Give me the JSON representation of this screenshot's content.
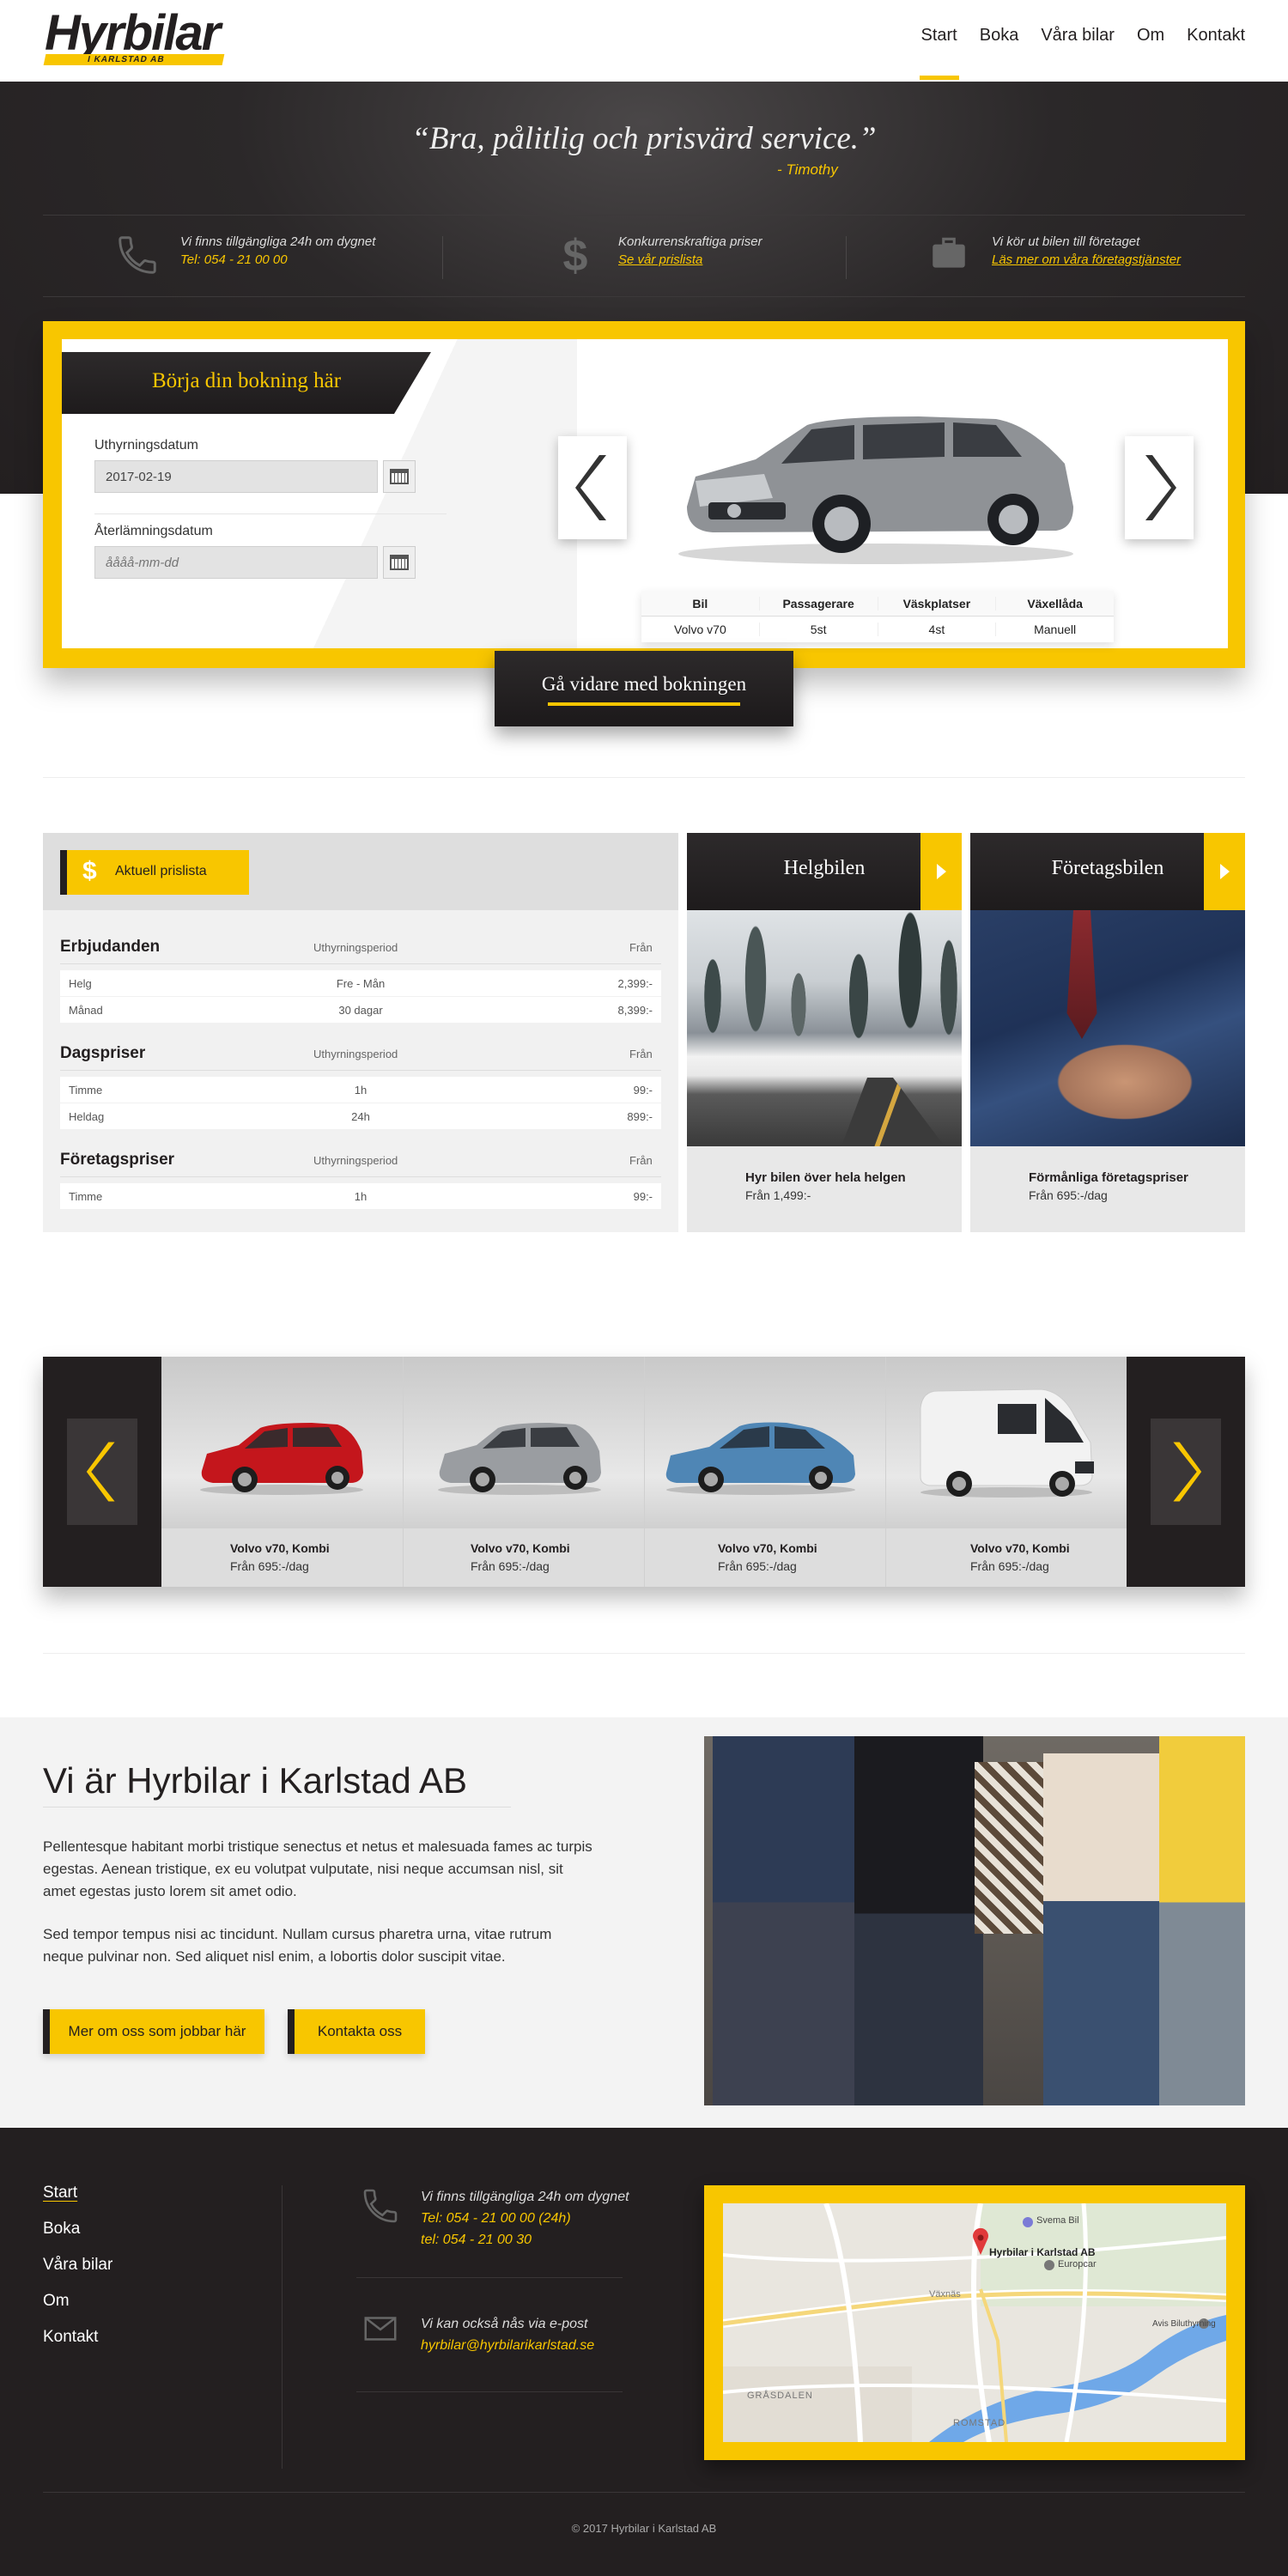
{
  "brand": {
    "name": "Hyrbilar",
    "sub": "I KARLSTAD AB"
  },
  "nav": [
    {
      "label": "Start",
      "active": true
    },
    {
      "label": "Boka"
    },
    {
      "label": "Våra bilar"
    },
    {
      "label": "Om"
    },
    {
      "label": "Kontakt"
    }
  ],
  "hero": {
    "quote": "“Bra, pålitlig och prisvärd service.”",
    "author": "- Timothy",
    "features": [
      {
        "icon": "phone-icon",
        "text": "Vi finns tillgängliga 24h om dygnet",
        "sub": "Tel: 054 - 21 00 00"
      },
      {
        "icon": "dollar-icon",
        "text": "Konkurrenskraftiga priser",
        "sub": "Se vår prislista"
      },
      {
        "icon": "briefcase-icon",
        "text": "Vi kör ut bilen till företaget",
        "sub": "Läs mer om våra företagstjänster"
      }
    ]
  },
  "booking": {
    "title": "Börja din bokning här",
    "rent_label": "Uthyrningsdatum",
    "rent_value": "2017-02-19",
    "return_label": "Återlämningsdatum",
    "return_placeholder": "åååå-mm-dd",
    "spec_headers": [
      "Bil",
      "Passagerare",
      "Väskplatser",
      "Växellåda"
    ],
    "spec_values": [
      "Volvo v70",
      "5st",
      "4st",
      "Manuell"
    ],
    "proceed": "Gå vidare med bokningen"
  },
  "prices": {
    "tag": "Aktuell prislista",
    "sections": [
      {
        "title": "Erbjudanden",
        "h2": "Uthyrningsperiod",
        "h3": "Från",
        "rows": [
          [
            "Helg",
            "Fre - Mån",
            "2,399:-"
          ],
          [
            "Månad",
            "30 dagar",
            "8,399:-"
          ]
        ]
      },
      {
        "title": "Dagspriser",
        "h2": "Uthyrningsperiod",
        "h3": "Från",
        "rows": [
          [
            "Timme",
            "1h",
            "99:-"
          ],
          [
            "Heldag",
            "24h",
            "899:-"
          ]
        ]
      },
      {
        "title": "Företagspriser",
        "h2": "Uthyrningsperiod",
        "h3": "Från",
        "rows": [
          [
            "Timme",
            "1h",
            "99:-"
          ]
        ]
      }
    ]
  },
  "promos": [
    {
      "title": "Helgbilen",
      "text": "Hyr bilen över hela helgen",
      "price": "Från 1,499:-"
    },
    {
      "title": "Företagsbilen",
      "text": "Förmånliga företagspriser",
      "price": "Från 695:-/dag"
    }
  ],
  "cars": [
    {
      "name": "Volvo v70, Kombi",
      "price": "Från 695:-/dag",
      "color": "#c4161c"
    },
    {
      "name": "Volvo v70, Kombi",
      "price": "Från 695:-/dag",
      "color": "#9a9da1"
    },
    {
      "name": "Volvo v70, Kombi",
      "price": "Från 695:-/dag",
      "color": "#4f86b5"
    },
    {
      "name": "Volvo v70, Kombi",
      "price": "Från 695:-/dag",
      "color": "#f2f2f2"
    }
  ],
  "about": {
    "title": "Vi är Hyrbilar i Karlstad AB",
    "p1": "Pellentesque habitant morbi tristique senectus et netus et malesuada fames ac turpis egestas. Aenean tristique, ex eu volutpat vulputate, nisi neque accumsan nisl, sit amet egestas justo lorem sit amet odio.",
    "p2": "Sed tempor tempus nisi ac tincidunt. Nullam cursus pharetra urna, vitae rutrum neque pulvinar non. Sed aliquet nisl enim, a lobortis dolor suscipit vitae.",
    "btn1": "Mer om oss som jobbar här",
    "btn2": "Kontakta oss"
  },
  "footer": {
    "nav": [
      "Start",
      "Boka",
      "Våra bilar",
      "Om",
      "Kontakt"
    ],
    "avail": "Vi finns tillgängliga 24h om dygnet",
    "tel1": "Tel: 054 - 21 00 00 (24h)",
    "tel2": "tel: 054 - 21 00 30",
    "mail_text": "Vi kan också nås via e-post",
    "email": "hyrbilar@hyrbilarikarlstad.se",
    "map_pin": "Hyrbilar i Karlstad AB",
    "map_labels": [
      "Svema Bil",
      "Europcar",
      "Växnäs",
      "GRÅSDALEN",
      "ROMSTAD",
      "Avis Biluthyrning"
    ],
    "copyright": "© 2017 Hyrbilar i Karlstad AB"
  },
  "colors": {
    "accent": "#f8c600",
    "dark": "#231f20"
  }
}
